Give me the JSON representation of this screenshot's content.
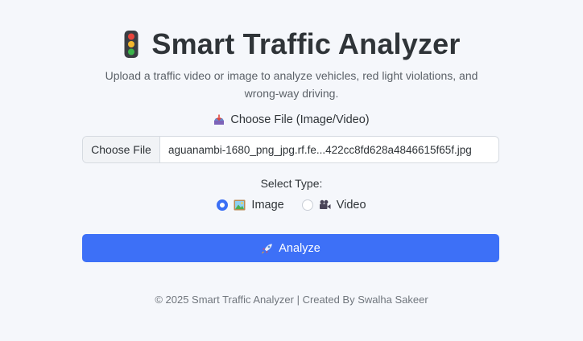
{
  "header": {
    "title": "Smart Traffic Analyzer",
    "title_icon": "traffic-light-icon",
    "subtitle": "Upload a traffic video or image to analyze vehicles, red light violations, and wrong-way driving."
  },
  "upload": {
    "label": "Choose File (Image/Video)",
    "label_icon": "inbox-tray-icon",
    "button_label": "Choose File",
    "file_name": "aguanambi-1680_png_jpg.rf.fe...422cc8fd628a4846615f65f.jpg"
  },
  "type_select": {
    "label": "Select Type:",
    "options": [
      {
        "label": "Image",
        "icon": "picture-icon",
        "checked": true
      },
      {
        "label": "Video",
        "icon": "movie-camera-icon",
        "checked": false
      }
    ]
  },
  "analyze": {
    "label": "Analyze",
    "icon": "rocket-icon"
  },
  "footer": {
    "text": "© 2025 Smart Traffic Analyzer | Created By Swalha Sakeer"
  },
  "colors": {
    "background": "#f5f7fb",
    "accent": "#3d70f7",
    "text": "#2f3438",
    "muted": "#5b6168"
  }
}
